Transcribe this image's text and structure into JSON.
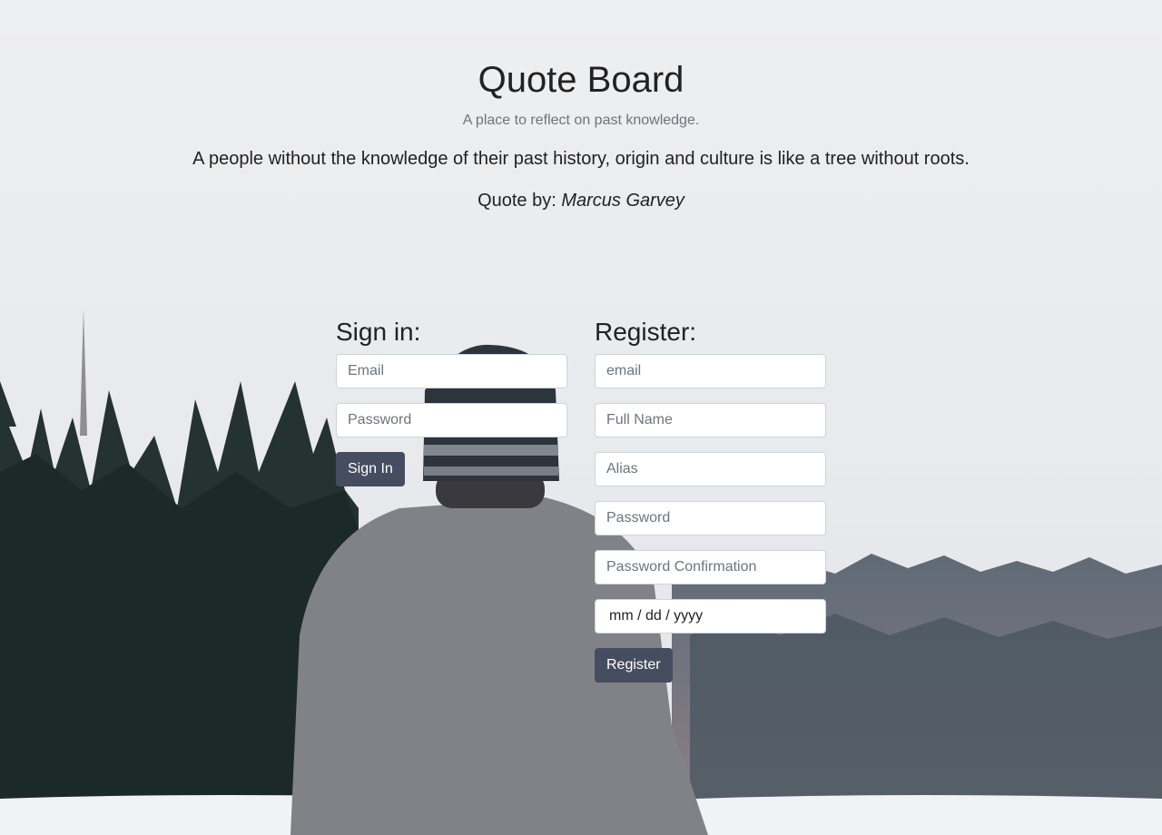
{
  "header": {
    "title": "Quote Board",
    "tagline": "A place to reflect on past knowledge.",
    "quote": "A people without the knowledge of their past history, origin and culture is like a tree without roots.",
    "byline_prefix": "Quote by: ",
    "author": "Marcus Garvey"
  },
  "signin": {
    "heading": "Sign in:",
    "email_placeholder": "Email",
    "password_placeholder": "Password",
    "button_label": "Sign In"
  },
  "register": {
    "heading": "Register:",
    "email_placeholder": "email",
    "fullname_placeholder": "Full Name",
    "alias_placeholder": "Alias",
    "password_placeholder": "Password",
    "password_confirm_placeholder": "Password Confirmation",
    "date_placeholder": "mm / dd / yyyy",
    "button_label": "Register"
  },
  "colors": {
    "button": "#474d60",
    "sky": "#e9eaec",
    "forest": "#23322f",
    "snow": "#f1f2f4",
    "sweater": "#808287",
    "beanie": "#2e343b"
  }
}
